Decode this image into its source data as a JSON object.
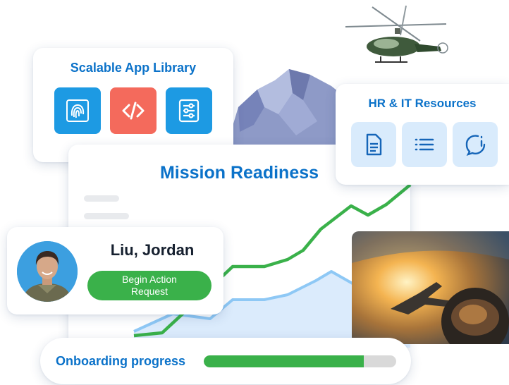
{
  "app_library": {
    "title": "Scalable App Library",
    "apps": [
      {
        "icon": "fingerprint-icon",
        "color": "#1d9ae3"
      },
      {
        "icon": "code-icon",
        "color": "#f46a5c"
      },
      {
        "icon": "sliders-icon",
        "color": "#1d9ae3"
      }
    ]
  },
  "resources": {
    "title": "HR & IT Resources",
    "items": [
      {
        "icon": "document-icon"
      },
      {
        "icon": "list-icon"
      },
      {
        "icon": "chat-icon"
      }
    ]
  },
  "readiness": {
    "title": "Mission Readiness"
  },
  "profile": {
    "name": "Liu, Jordan",
    "action_label": "Begin Action Request"
  },
  "onboarding": {
    "label": "Onboarding progress",
    "progress": 0.83
  },
  "colors": {
    "accent_blue": "#0b72c9",
    "green": "#3ab14a",
    "coral": "#f46a5c"
  }
}
